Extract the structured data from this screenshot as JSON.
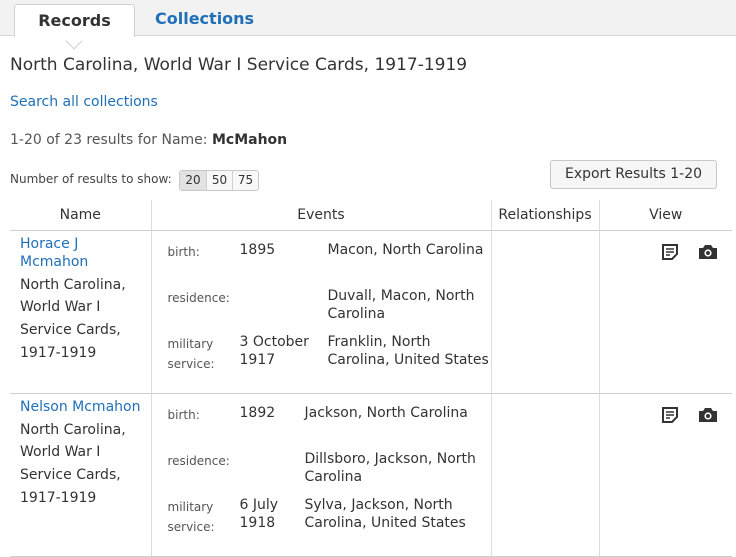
{
  "tabs": {
    "records": "Records",
    "collections": "Collections"
  },
  "page_title": "North Carolina, World War I Service Cards, 1917-1919",
  "search_all_link": "Search all collections",
  "results": {
    "prefix": "1-20 of 23 results for Name:",
    "query": "McMahon"
  },
  "results_per_page": {
    "label": "Number of results to show:",
    "options": [
      "20",
      "50",
      "75"
    ],
    "selected": "20"
  },
  "export_button": "Export Results 1-20",
  "table": {
    "headers": [
      "Name",
      "Events",
      "Relationships",
      "View"
    ],
    "rows": [
      {
        "name": "Horace J Mcmahon",
        "collection": "North Carolina, World War I Service Cards, 1917-1919",
        "events": [
          {
            "label": "birth:",
            "date": "1895",
            "place": "Macon, North Carolina"
          },
          {
            "label": "residence:",
            "date": "",
            "place": "Duvall, Macon, North Carolina"
          },
          {
            "label": "military service:",
            "date": "3 October 1917",
            "place": "Franklin, North Carolina, United States"
          }
        ],
        "relationships": "",
        "view_icons": [
          "record-icon",
          "camera-icon"
        ]
      },
      {
        "name": "Nelson Mcmahon",
        "collection": "North Carolina, World War I Service Cards, 1917-1919",
        "events": [
          {
            "label": "birth:",
            "date": "1892",
            "place": "Jackson, North Carolina"
          },
          {
            "label": "residence:",
            "date": "",
            "place": "Dillsboro, Jackson, North Carolina"
          },
          {
            "label": "military service:",
            "date": "6 July 1918",
            "place": "Sylva, Jackson, North Carolina, United States"
          }
        ],
        "relationships": "",
        "view_icons": [
          "record-icon",
          "camera-icon"
        ]
      }
    ]
  },
  "colors": {
    "link": "#1f6fb8",
    "text": "#333333",
    "tabbar": "#f2f2f2"
  }
}
